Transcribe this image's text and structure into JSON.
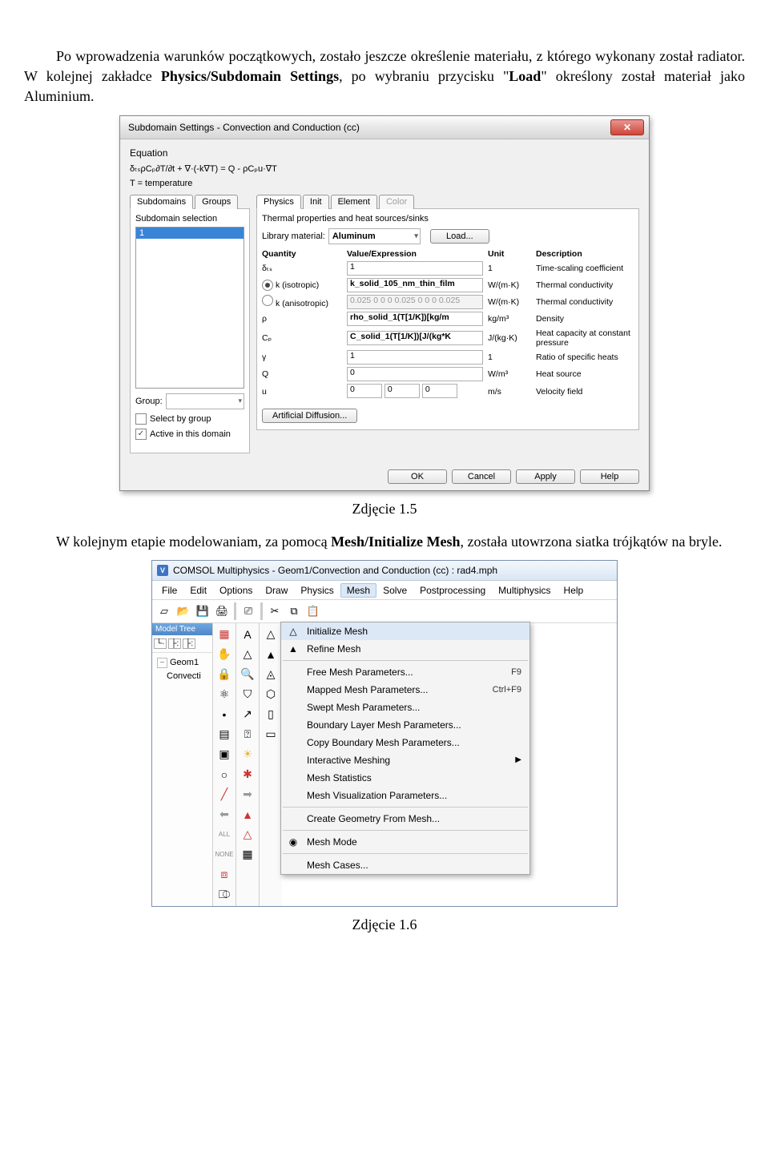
{
  "para1_a": "Po wprowadzenia warunków początkowych, zostało jeszcze określenie materiału, z którego wykonany został radiator. W kolejnej zakładce ",
  "para1_b": "Physics/Subdomain Settings",
  "para1_c": ", po wybraniu przycisku \"",
  "para1_d": "Load",
  "para1_e": "\" określony został materiał jako Aluminium.",
  "caption1": "Zdjęcie 1.5",
  "para2_a": "W kolejnym etapie modelowaniam, za pomocą ",
  "para2_b": "Mesh/Initialize Mesh",
  "para2_c": ",  została utowrzona siatka trójkątów na bryle.",
  "caption2": "Zdjęcie 1.6",
  "dlg": {
    "title": "Subdomain Settings - Convection and Conduction (cc)",
    "eq_label": "Equation",
    "eq_line1": "δₜₛρCₚ∂T/∂t + ∇·(-k∇T) = Q - ρCₚu·∇T",
    "eq_line2": "T = temperature",
    "tabs_left": [
      "Subdomains",
      "Groups"
    ],
    "tabs_right": [
      "Physics",
      "Init",
      "Element",
      "Color"
    ],
    "subsel": "Subdomain selection",
    "subsel_item": "1",
    "group_lbl": "Group:",
    "ck_select": "Select by group",
    "ck_active": "Active in this domain",
    "panel_title": "Thermal properties and heat sources/sinks",
    "libmat_lbl": "Library material:",
    "libmat_val": "Aluminum",
    "load_btn": "Load...",
    "cols": [
      "Quantity",
      "Value/Expression",
      "Unit",
      "Description"
    ],
    "rows": [
      {
        "q": "δₜₛ",
        "v": "1",
        "u": "1",
        "d": "Time-scaling coefficient",
        "radio": "",
        "bold": false
      },
      {
        "q": "k (isotropic)",
        "v": "k_solid_105_nm_thin_film",
        "u": "W/(m·K)",
        "d": "Thermal conductivity",
        "radio": "on",
        "bold": true
      },
      {
        "q": "k (anisotropic)",
        "v": "0.025 0 0 0 0.025 0 0 0 0.025",
        "u": "W/(m·K)",
        "d": "Thermal conductivity",
        "radio": "off",
        "dis": true
      },
      {
        "q": "ρ",
        "v": "rho_solid_1(T[1/K])[kg/m",
        "u": "kg/m³",
        "d": "Density",
        "bold": true
      },
      {
        "q": "Cₚ",
        "v": "C_solid_1(T[1/K])[J/(kg*K",
        "u": "J/(kg·K)",
        "d": "Heat capacity at constant pressure",
        "bold": true
      },
      {
        "q": "γ",
        "v": "1",
        "u": "1",
        "d": "Ratio of specific heats"
      },
      {
        "q": "Q",
        "v": "0",
        "u": "W/m³",
        "d": "Heat source"
      },
      {
        "q": "u",
        "v": "0|0|0",
        "u": "m/s",
        "d": "Velocity field",
        "triple": true
      }
    ],
    "artdiff": "Artificial Diffusion...",
    "buttons": [
      "OK",
      "Cancel",
      "Apply",
      "Help"
    ]
  },
  "win": {
    "title": "COMSOL Multiphysics - Geom1/Convection and Conduction (cc) : rad4.mph",
    "menus": [
      "File",
      "Edit",
      "Options",
      "Draw",
      "Physics",
      "Mesh",
      "Solve",
      "Postprocessing",
      "Multiphysics",
      "Help"
    ],
    "tree_hdr": "Model Tree",
    "tree": [
      "Geom1",
      "Convecti"
    ],
    "menu_items": [
      {
        "ic": "△",
        "t": "Initialize Mesh",
        "hl": true
      },
      {
        "ic": "▲",
        "t": "Refine Mesh"
      },
      {
        "sep": true
      },
      {
        "t": "Free Mesh Parameters...",
        "sc": "F9"
      },
      {
        "t": "Mapped Mesh Parameters...",
        "sc": "Ctrl+F9"
      },
      {
        "t": "Swept Mesh Parameters..."
      },
      {
        "t": "Boundary Layer Mesh Parameters..."
      },
      {
        "t": "Copy Boundary Mesh Parameters..."
      },
      {
        "t": "Interactive Meshing",
        "arrow": true
      },
      {
        "t": "Mesh Statistics"
      },
      {
        "t": "Mesh Visualization Parameters..."
      },
      {
        "sep": true
      },
      {
        "t": "Create Geometry From Mesh..."
      },
      {
        "sep": true
      },
      {
        "ic": "◉",
        "t": "Mesh Mode"
      },
      {
        "sep": true
      },
      {
        "t": "Mesh Cases..."
      }
    ]
  }
}
